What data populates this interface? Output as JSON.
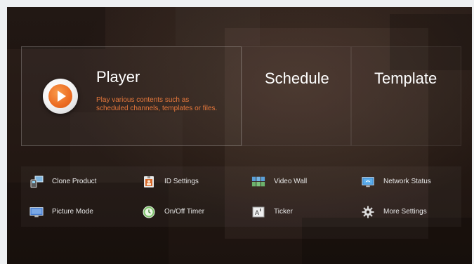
{
  "main_tiles": {
    "player": {
      "title": "Player",
      "description": "Play various contents such as scheduled channels, templates or files."
    },
    "schedule": {
      "title": "Schedule"
    },
    "template": {
      "title": "Template"
    }
  },
  "quick_items": [
    {
      "label": "Clone Product",
      "icon": "clone-product-icon"
    },
    {
      "label": "ID Settings",
      "icon": "id-settings-icon"
    },
    {
      "label": "Video Wall",
      "icon": "video-wall-icon"
    },
    {
      "label": "Network Status",
      "icon": "network-status-icon"
    },
    {
      "label": "Picture Mode",
      "icon": "picture-mode-icon"
    },
    {
      "label": "On/Off Timer",
      "icon": "on-off-timer-icon"
    },
    {
      "label": "Ticker",
      "icon": "ticker-icon"
    },
    {
      "label": "More Settings",
      "icon": "gear-icon"
    }
  ],
  "colors": {
    "accent_orange": "#ec6d23",
    "background": "#231813",
    "text": "#ffffff"
  }
}
